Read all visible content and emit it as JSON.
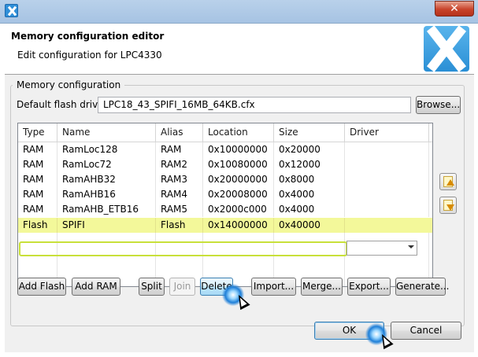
{
  "window": {
    "title": "",
    "close_label": "✕"
  },
  "header": {
    "title": "Memory configuration editor",
    "subtitle": "Edit configuration for LPC4330"
  },
  "memory_config": {
    "group_label": "Memory configuration",
    "default_flash_driver_label": "Default flash driver",
    "default_flash_driver_value": "LPC18_43_SPIFI_16MB_64KB.cfx",
    "browse_label": "Browse..."
  },
  "table": {
    "columns": [
      "Type",
      "Name",
      "Alias",
      "Location",
      "Size",
      "Driver"
    ],
    "rows": [
      {
        "type": "RAM",
        "name": "RamLoc128",
        "alias": "RAM",
        "location": "0x10000000",
        "size": "0x20000",
        "driver": ""
      },
      {
        "type": "RAM",
        "name": "RamLoc72",
        "alias": "RAM2",
        "location": "0x10080000",
        "size": "0x12000",
        "driver": ""
      },
      {
        "type": "RAM",
        "name": "RamAHB32",
        "alias": "RAM3",
        "location": "0x20000000",
        "size": "0x8000",
        "driver": ""
      },
      {
        "type": "RAM",
        "name": "RamAHB16",
        "alias": "RAM4",
        "location": "0x20008000",
        "size": "0x4000",
        "driver": ""
      },
      {
        "type": "RAM",
        "name": "RamAHB_ETB16",
        "alias": "RAM5",
        "location": "0x2000c000",
        "size": "0x4000",
        "driver": ""
      },
      {
        "type": "Flash",
        "name": "SPIFI",
        "alias": "Flash",
        "location": "0x14000000",
        "size": "0x40000",
        "driver": ""
      }
    ],
    "selected_row": 5
  },
  "buttons": {
    "add_flash": "Add Flash",
    "add_ram": "Add RAM",
    "split": "Split",
    "join": "Join",
    "delete": "Delete",
    "import": "Import...",
    "merge": "Merge...",
    "export": "Export...",
    "generate": "Generate...",
    "ok": "OK",
    "cancel": "Cancel"
  },
  "colors": {
    "selected_row": "#f3f89a",
    "selection_frame": "#c8e03a",
    "logo_blue": "#2a8fd5"
  }
}
